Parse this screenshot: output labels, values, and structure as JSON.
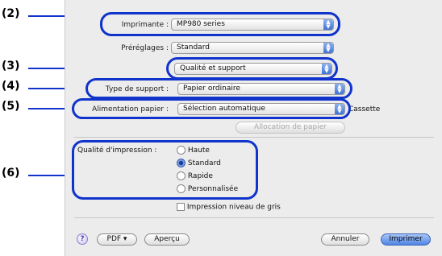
{
  "callouts": [
    "(2)",
    "(3)",
    "(4)",
    "(5)",
    "(6)"
  ],
  "printer": {
    "label": "Imprimante :",
    "value": "MP980 series"
  },
  "presets": {
    "label": "Préréglages :",
    "value": "Standard"
  },
  "panel": {
    "value": "Qualité et support"
  },
  "media_type": {
    "label": "Type de support :",
    "value": "Papier ordinaire"
  },
  "paper_feed": {
    "label": "Alimentation papier :",
    "value": "Sélection automatique",
    "suffix": "Cassette"
  },
  "paper_allocation_button": "Allocation de papier",
  "print_quality": {
    "label": "Qualité d'impression :",
    "options": [
      "Haute",
      "Standard",
      "Rapide",
      "Personnalisée"
    ],
    "selected": "Standard"
  },
  "grayscale_checkbox": {
    "label": "Impression niveau de gris",
    "checked": false
  },
  "footer": {
    "help": "?",
    "pdf": "PDF ▾",
    "preview": "Aperçu",
    "cancel": "Annuler",
    "print": "Imprimer"
  },
  "colors": {
    "callout_blue": "#1033cc",
    "default_button": "#4f86e6"
  },
  "icons": {
    "popup_arrows": "updown-arrows-icon",
    "help": "help-icon"
  }
}
